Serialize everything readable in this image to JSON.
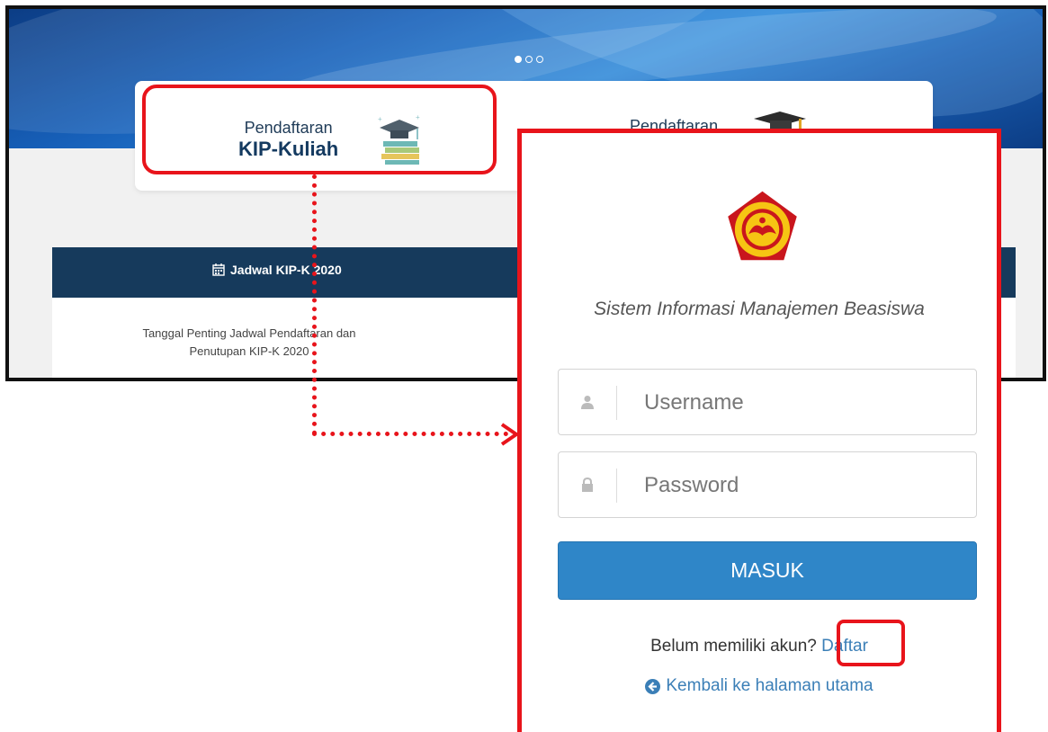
{
  "carousel": {
    "slides": 3,
    "active_index": 0
  },
  "registration": {
    "kip": {
      "line1": "Pendaftaran",
      "line2": "KIP-Kuliah",
      "icon": "books-graduation-cap-icon"
    },
    "other": {
      "line1": "Pendaftaran",
      "icon": "graduation-cap-icon"
    }
  },
  "jadwal": {
    "title": "Jadwal KIP-K 2020",
    "icon": "calendar-icon",
    "description": "Tanggal Penting Jadwal Pendaftaran dan Penutupan KIP-K 2020"
  },
  "login": {
    "logo": "universitas-cenderawasih-logo",
    "title": "Sistem Informasi Manajemen Beasiswa",
    "username_placeholder": "Username",
    "password_placeholder": "Password",
    "submit_label": "MASUK",
    "signup_prompt": "Belum memiliki akun?",
    "signup_link": "Daftar",
    "back_link": "Kembali ke halaman utama"
  },
  "colors": {
    "highlight": "#e8141b",
    "primary_button": "#2f86c8",
    "header_navy": "#163a5c",
    "link": "#3b7fb7"
  }
}
